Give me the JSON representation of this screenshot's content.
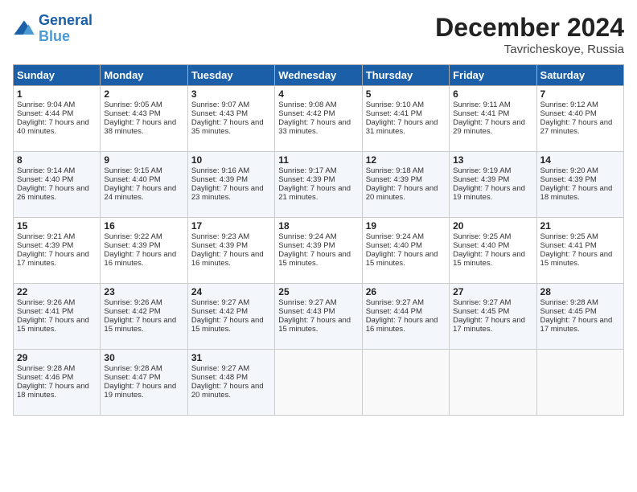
{
  "header": {
    "month_title": "December 2024",
    "location": "Tavricheskoye, Russia"
  },
  "calendar": {
    "columns": [
      "Sunday",
      "Monday",
      "Tuesday",
      "Wednesday",
      "Thursday",
      "Friday",
      "Saturday"
    ]
  },
  "weeks": [
    [
      {
        "day": "1",
        "sunrise": "9:04 AM",
        "sunset": "4:44 PM",
        "daylight": "7 hours and 40 minutes."
      },
      {
        "day": "2",
        "sunrise": "9:05 AM",
        "sunset": "4:43 PM",
        "daylight": "7 hours and 38 minutes."
      },
      {
        "day": "3",
        "sunrise": "9:07 AM",
        "sunset": "4:43 PM",
        "daylight": "7 hours and 35 minutes."
      },
      {
        "day": "4",
        "sunrise": "9:08 AM",
        "sunset": "4:42 PM",
        "daylight": "7 hours and 33 minutes."
      },
      {
        "day": "5",
        "sunrise": "9:10 AM",
        "sunset": "4:41 PM",
        "daylight": "7 hours and 31 minutes."
      },
      {
        "day": "6",
        "sunrise": "9:11 AM",
        "sunset": "4:41 PM",
        "daylight": "7 hours and 29 minutes."
      },
      {
        "day": "7",
        "sunrise": "9:12 AM",
        "sunset": "4:40 PM",
        "daylight": "7 hours and 27 minutes."
      }
    ],
    [
      {
        "day": "8",
        "sunrise": "9:14 AM",
        "sunset": "4:40 PM",
        "daylight": "7 hours and 26 minutes."
      },
      {
        "day": "9",
        "sunrise": "9:15 AM",
        "sunset": "4:40 PM",
        "daylight": "7 hours and 24 minutes."
      },
      {
        "day": "10",
        "sunrise": "9:16 AM",
        "sunset": "4:39 PM",
        "daylight": "7 hours and 23 minutes."
      },
      {
        "day": "11",
        "sunrise": "9:17 AM",
        "sunset": "4:39 PM",
        "daylight": "7 hours and 21 minutes."
      },
      {
        "day": "12",
        "sunrise": "9:18 AM",
        "sunset": "4:39 PM",
        "daylight": "7 hours and 20 minutes."
      },
      {
        "day": "13",
        "sunrise": "9:19 AM",
        "sunset": "4:39 PM",
        "daylight": "7 hours and 19 minutes."
      },
      {
        "day": "14",
        "sunrise": "9:20 AM",
        "sunset": "4:39 PM",
        "daylight": "7 hours and 18 minutes."
      }
    ],
    [
      {
        "day": "15",
        "sunrise": "9:21 AM",
        "sunset": "4:39 PM",
        "daylight": "7 hours and 17 minutes."
      },
      {
        "day": "16",
        "sunrise": "9:22 AM",
        "sunset": "4:39 PM",
        "daylight": "7 hours and 16 minutes."
      },
      {
        "day": "17",
        "sunrise": "9:23 AM",
        "sunset": "4:39 PM",
        "daylight": "7 hours and 16 minutes."
      },
      {
        "day": "18",
        "sunrise": "9:24 AM",
        "sunset": "4:39 PM",
        "daylight": "7 hours and 15 minutes."
      },
      {
        "day": "19",
        "sunrise": "9:24 AM",
        "sunset": "4:40 PM",
        "daylight": "7 hours and 15 minutes."
      },
      {
        "day": "20",
        "sunrise": "9:25 AM",
        "sunset": "4:40 PM",
        "daylight": "7 hours and 15 minutes."
      },
      {
        "day": "21",
        "sunrise": "9:25 AM",
        "sunset": "4:41 PM",
        "daylight": "7 hours and 15 minutes."
      }
    ],
    [
      {
        "day": "22",
        "sunrise": "9:26 AM",
        "sunset": "4:41 PM",
        "daylight": "7 hours and 15 minutes."
      },
      {
        "day": "23",
        "sunrise": "9:26 AM",
        "sunset": "4:42 PM",
        "daylight": "7 hours and 15 minutes."
      },
      {
        "day": "24",
        "sunrise": "9:27 AM",
        "sunset": "4:42 PM",
        "daylight": "7 hours and 15 minutes."
      },
      {
        "day": "25",
        "sunrise": "9:27 AM",
        "sunset": "4:43 PM",
        "daylight": "7 hours and 15 minutes."
      },
      {
        "day": "26",
        "sunrise": "9:27 AM",
        "sunset": "4:44 PM",
        "daylight": "7 hours and 16 minutes."
      },
      {
        "day": "27",
        "sunrise": "9:27 AM",
        "sunset": "4:45 PM",
        "daylight": "7 hours and 17 minutes."
      },
      {
        "day": "28",
        "sunrise": "9:28 AM",
        "sunset": "4:45 PM",
        "daylight": "7 hours and 17 minutes."
      }
    ],
    [
      {
        "day": "29",
        "sunrise": "9:28 AM",
        "sunset": "4:46 PM",
        "daylight": "7 hours and 18 minutes."
      },
      {
        "day": "30",
        "sunrise": "9:28 AM",
        "sunset": "4:47 PM",
        "daylight": "7 hours and 19 minutes."
      },
      {
        "day": "31",
        "sunrise": "9:27 AM",
        "sunset": "4:48 PM",
        "daylight": "7 hours and 20 minutes."
      },
      null,
      null,
      null,
      null
    ]
  ]
}
